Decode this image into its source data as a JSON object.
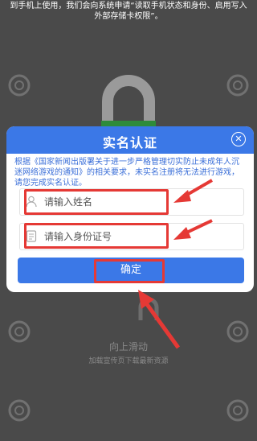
{
  "background": {
    "top_text": "到手机上使用，我们会向系统申请“读取手机状态和身份、启用写入外部存储卡权限”。",
    "bottom_title": "向上滑动",
    "bottom_sub": "加载宣传页下载最新资源"
  },
  "dialog": {
    "title": "实名认证",
    "notice": "根据《国家新闻出版署关于进一步严格管理切实防止未成年人沉迷网络游戏的通知》的相关要求，未实名注册将无法进行游戏，请您完成实名认证。",
    "name_placeholder": "请输入姓名",
    "id_placeholder": "请输入身份证号",
    "confirm_label": "确定"
  },
  "colors": {
    "accent": "#3b78e7",
    "annotation": "#e53935",
    "backdrop": "#4a4a4a",
    "lock_green": "#2e8b3a"
  },
  "icons": [
    "close-icon",
    "person-icon",
    "id-card-icon",
    "gear-icon",
    "padlock-icon",
    "arrow-icon"
  ]
}
